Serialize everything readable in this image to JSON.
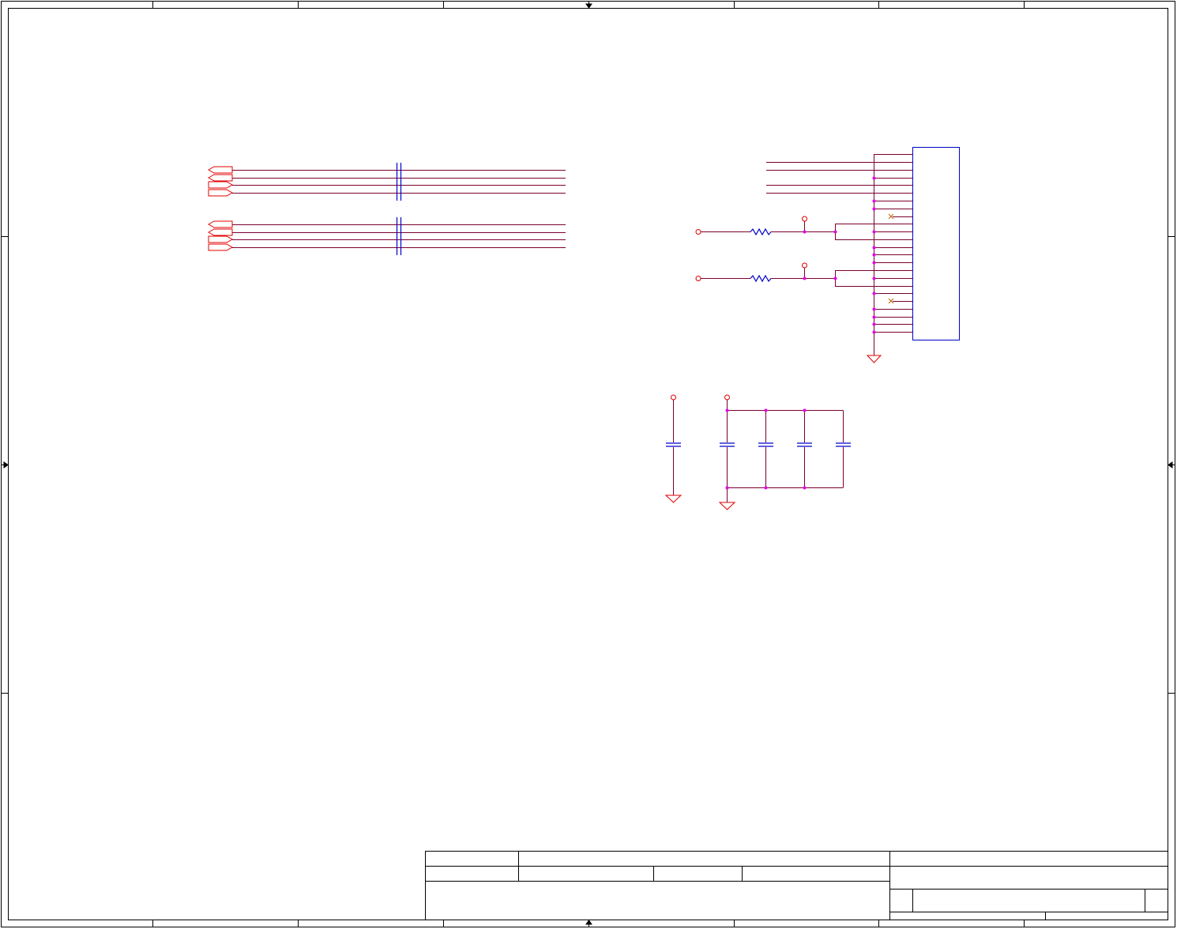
{
  "sheet": {
    "background": "#ffffff",
    "border_color": "#000000",
    "wire_color": "#7a0030",
    "port_color": "#e00000",
    "power_color": "#cc0000",
    "component_color": "#0000cc",
    "junction_color": "#e600e6",
    "noconnect_color": "#c06000"
  },
  "zones": {
    "top_arrow": "arrow-down-icon",
    "bottom_arrow": "arrow-up-icon",
    "left_arrow": "arrow-right-icon",
    "right_arrow": "arrow-left-icon"
  },
  "title_block": {
    "title": "",
    "size": "",
    "document_number": "",
    "rev": "",
    "date": "",
    "sheet": ""
  }
}
